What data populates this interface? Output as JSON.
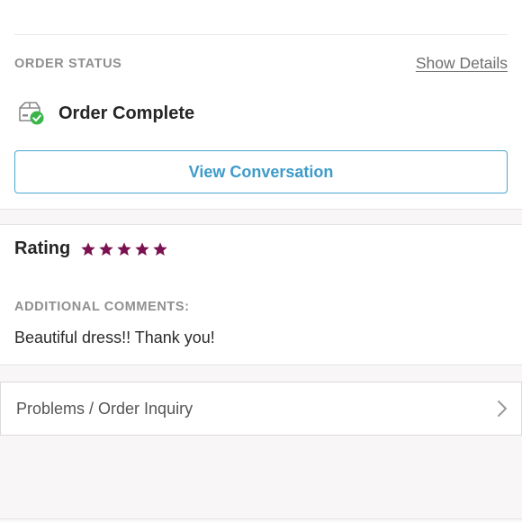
{
  "order_status": {
    "label": "ORDER STATUS",
    "details_link": "Show Details",
    "status_text": "Order Complete",
    "status_icon": "package-check-icon"
  },
  "actions": {
    "view_conversation": "View Conversation"
  },
  "rating": {
    "label": "Rating",
    "stars": 5,
    "max_stars": 5,
    "star_color": "#7a1150"
  },
  "comments": {
    "label": "ADDITIONAL COMMENTS:",
    "text": "Beautiful dress!! Thank you!"
  },
  "inquiry": {
    "label": "Problems / Order Inquiry",
    "icon": "chevron-right-icon"
  },
  "colors": {
    "accent_blue": "#3d9bc9",
    "success_green": "#3bb54a"
  }
}
